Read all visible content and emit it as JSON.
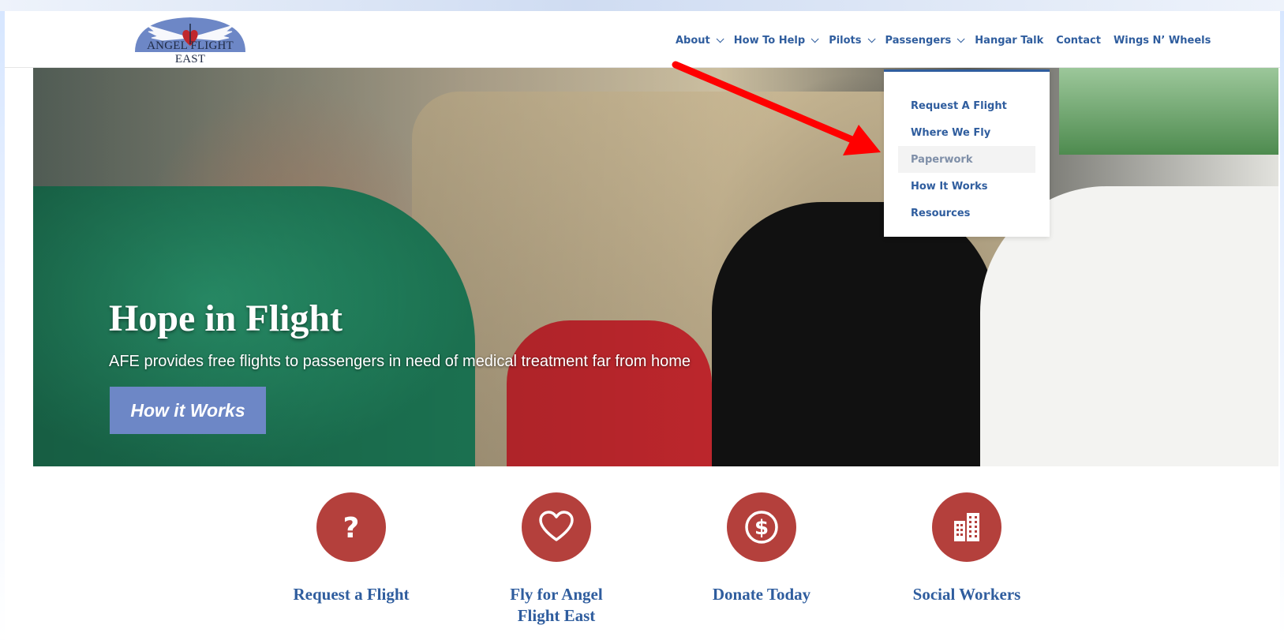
{
  "logo": {
    "text": "ANGEL FLIGHT EAST"
  },
  "nav": {
    "items": [
      {
        "label": "About",
        "has_menu": true
      },
      {
        "label": "How To Help",
        "has_menu": true
      },
      {
        "label": "Pilots",
        "has_menu": true
      },
      {
        "label": "Passengers",
        "has_menu": true
      },
      {
        "label": "Hangar Talk",
        "has_menu": false
      },
      {
        "label": "Contact",
        "has_menu": false
      },
      {
        "label": "Wings N’ Wheels",
        "has_menu": false
      }
    ]
  },
  "dropdown": {
    "items": [
      {
        "label": "Request A Flight"
      },
      {
        "label": "Where We Fly"
      },
      {
        "label": "Paperwork",
        "active": true
      },
      {
        "label": "How It Works"
      },
      {
        "label": "Resources"
      }
    ]
  },
  "hero": {
    "title": "Hope in Flight",
    "subtitle": "AFE provides free flights to passengers in need of medical treatment far from home",
    "button_label": "How it Works"
  },
  "features": [
    {
      "icon": "question-icon",
      "label_line1": "Request a Flight",
      "label_line2": ""
    },
    {
      "icon": "heart-icon",
      "label_line1": "Fly for Angel",
      "label_line2": "Flight East"
    },
    {
      "icon": "dollar-icon",
      "label_line1": "Donate Today",
      "label_line2": ""
    },
    {
      "icon": "building-icon",
      "label_line1": "Social Workers",
      "label_line2": ""
    }
  ],
  "colors": {
    "brand_blue": "#2f5d9e",
    "button_blue": "#6d87c6",
    "icon_red": "#b4403c",
    "arrow_red": "#ff0000"
  }
}
